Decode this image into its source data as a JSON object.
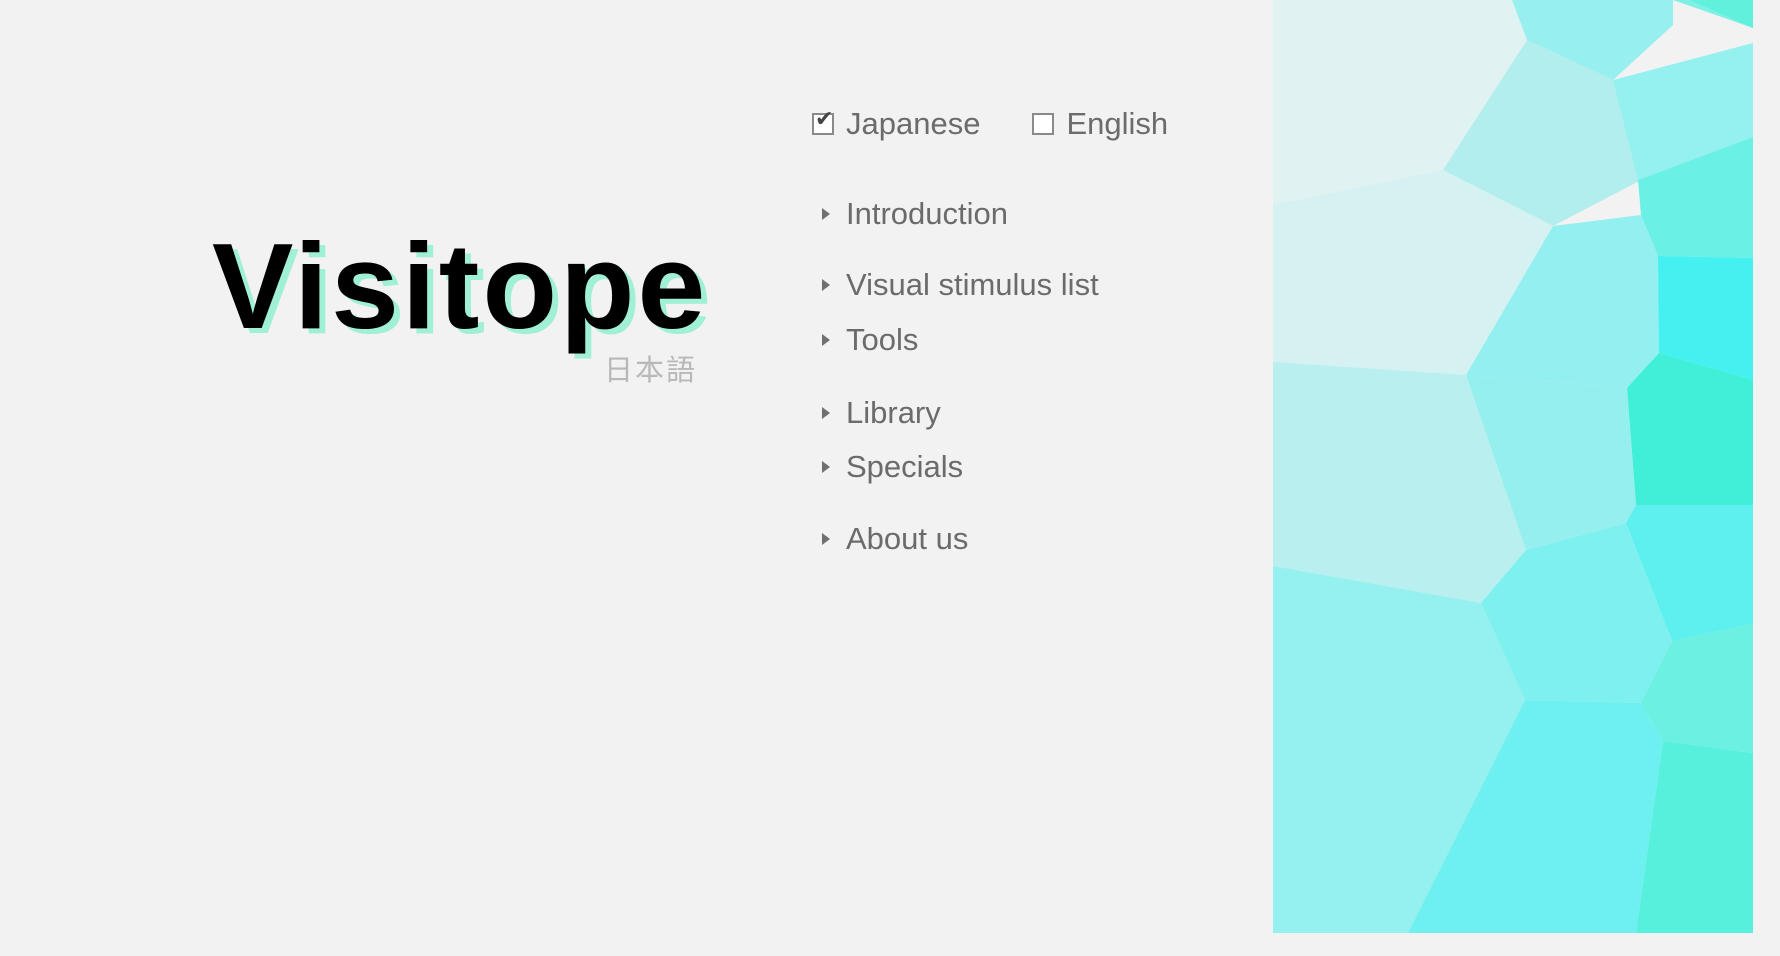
{
  "logo": {
    "word": "Visitope",
    "language_caption": "日本語",
    "colors": {
      "text": "#000000",
      "shadow": "#9ff0d5"
    }
  },
  "language": {
    "options": [
      {
        "label": "Japanese",
        "checked": true
      },
      {
        "label": "English",
        "checked": false
      }
    ]
  },
  "menu": {
    "arrow_icon": "triangle-right-icon",
    "items": [
      {
        "label": "Introduction"
      },
      {
        "label": "Visual stimulus list"
      },
      {
        "label": "Tools"
      },
      {
        "label": "Library"
      },
      {
        "label": "Specials"
      },
      {
        "label": "About us"
      }
    ]
  },
  "theme": {
    "background": "#f2f2f2",
    "text": "#6b6b6b",
    "accent_cyan": "#45f0f0",
    "accent_mint": "#40f0d8"
  }
}
